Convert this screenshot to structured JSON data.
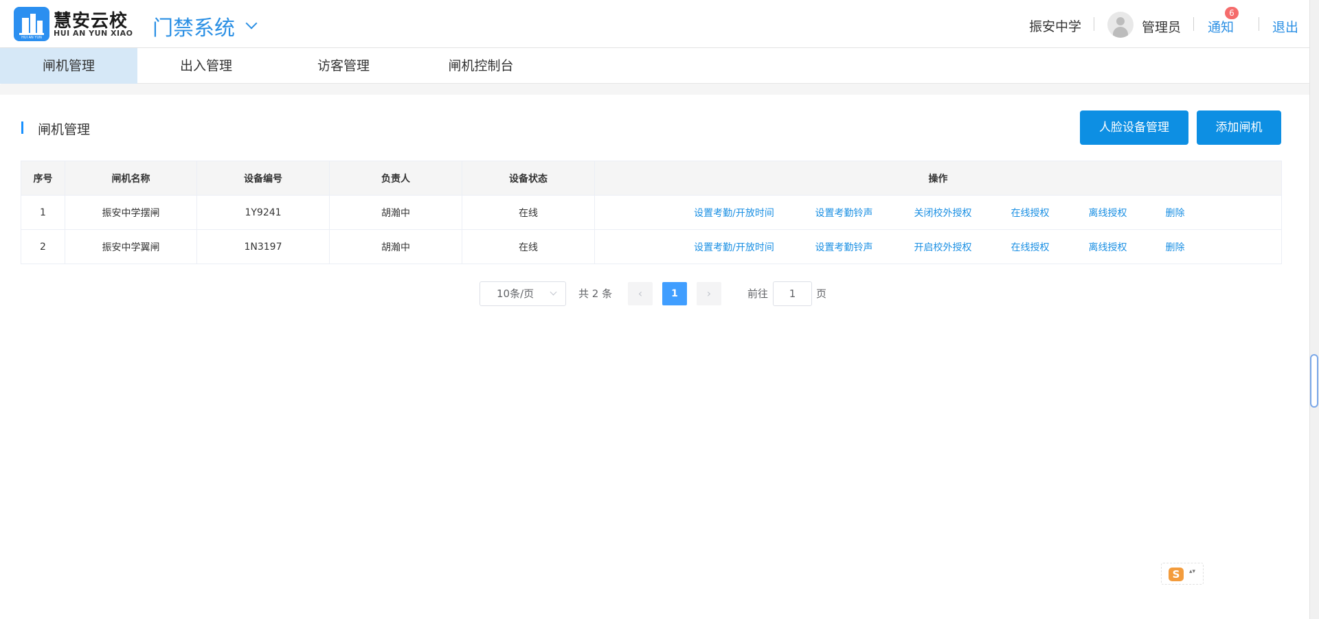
{
  "header": {
    "logo_cn": "慧安云校",
    "logo_en": "HUI AN YUN XIAO",
    "logo_tiny": "HUI AN YUN",
    "system_title": "门禁系统",
    "school": "振安中学",
    "admin": "管理员",
    "notice_label": "通知",
    "notice_count": "6",
    "logout_label": "退出"
  },
  "tabs": [
    {
      "label": "闸机管理",
      "active": true
    },
    {
      "label": "出入管理",
      "active": false
    },
    {
      "label": "访客管理",
      "active": false
    },
    {
      "label": "闸机控制台",
      "active": false
    }
  ],
  "section": {
    "title": "闸机管理",
    "face_btn": "人脸设备管理",
    "add_btn": "添加闸机"
  },
  "table": {
    "headers": [
      "序号",
      "闸机名称",
      "设备编号",
      "负责人",
      "设备状态",
      "操作"
    ],
    "rows": [
      {
        "no": "1",
        "name": "振安中学摆闸",
        "code": "1Y9241",
        "owner": "胡瀚中",
        "status": "在线",
        "ops": [
          "设置考勤/开放时间",
          "设置考勤铃声",
          "关闭校外授权",
          "在线授权",
          "离线授权",
          "删除"
        ]
      },
      {
        "no": "2",
        "name": "振安中学翼闸",
        "code": "1N3197",
        "owner": "胡瀚中",
        "status": "在线",
        "ops": [
          "设置考勤/开放时间",
          "设置考勤铃声",
          "开启校外授权",
          "在线授权",
          "离线授权",
          "删除"
        ]
      }
    ]
  },
  "pagination": {
    "page_size": "10条/页",
    "total": "共 2 条",
    "prev": "‹",
    "current": "1",
    "next": "›",
    "goto_label": "前往",
    "goto_value": "1",
    "page_suffix": "页"
  },
  "ime": {
    "icon": "S",
    "arrows": "▴▾"
  },
  "colors": {
    "accent": "#0d8fe3",
    "link": "#1a8fe3",
    "active_tab": "#d6e8f7",
    "badge": "#f56c6c"
  }
}
